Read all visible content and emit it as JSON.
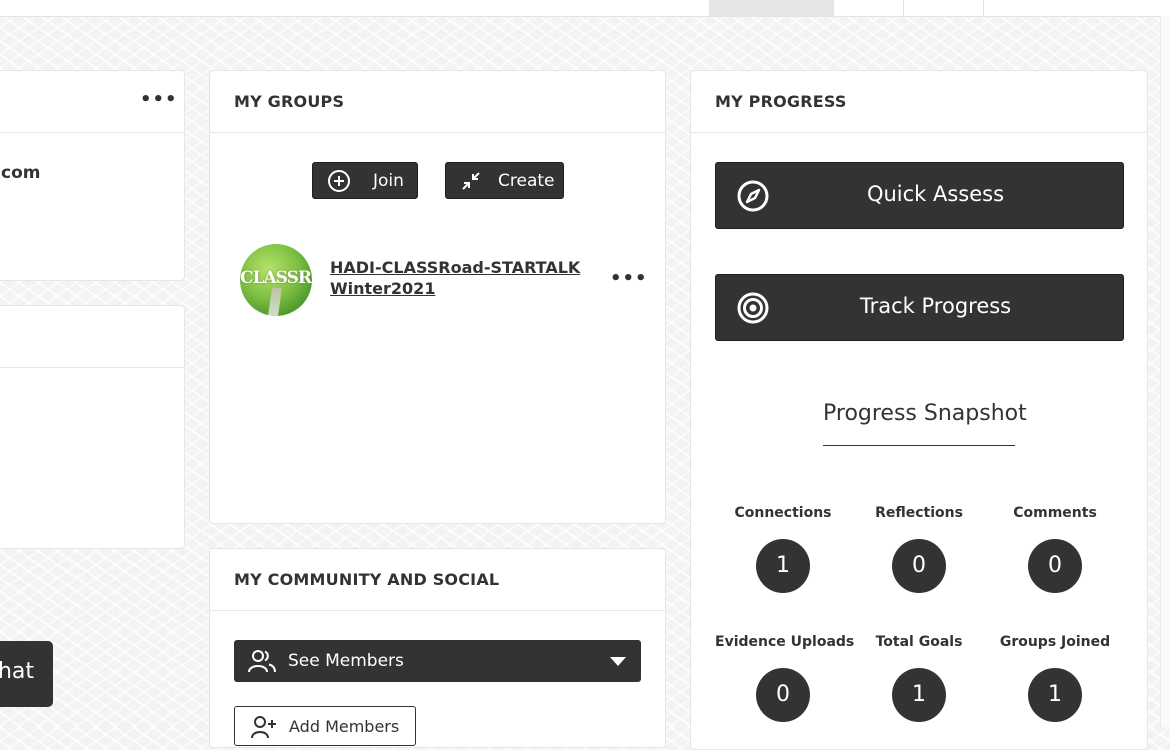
{
  "left_column": {
    "email_fragment": "com",
    "chat_label": "hat"
  },
  "my_groups": {
    "title": "MY GROUPS",
    "join_label": "Join",
    "create_label": "Create",
    "group": {
      "logo_text": "CLASSROAD",
      "name_line1": "HADI-CLASSRoad-STARTALK",
      "name_line2": "Winter2021"
    }
  },
  "community": {
    "title": "MY COMMUNITY AND SOCIAL",
    "see_members_label": "See Members",
    "add_members_label": "Add Members"
  },
  "my_progress": {
    "title": "MY PROGRESS",
    "quick_assess_label": "Quick Assess",
    "track_progress_label": "Track Progress",
    "snapshot_title": "Progress Snapshot",
    "stats": [
      {
        "label": "Connections",
        "value": "1"
      },
      {
        "label": "Reflections",
        "value": "0"
      },
      {
        "label": "Comments",
        "value": "0"
      },
      {
        "label": "Evidence Uploads",
        "value": "0"
      },
      {
        "label": "Total Goals",
        "value": "1"
      },
      {
        "label": "Groups Joined",
        "value": "1"
      }
    ]
  },
  "colors": {
    "dark": "#333333",
    "card_bg": "#ffffff",
    "border": "#e6e6e6"
  }
}
